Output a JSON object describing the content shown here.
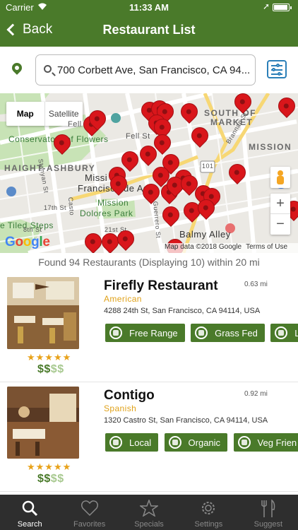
{
  "status_bar": {
    "carrier": "Carrier",
    "time": "11:33 AM"
  },
  "nav": {
    "back_label": "Back",
    "title": "Restaurant List"
  },
  "search": {
    "value": "700 Corbett Ave, San Francisco, CA 94..."
  },
  "map": {
    "type_map": "Map",
    "type_satellite": "Satellite",
    "labels": {
      "south_of_market": "SOUTH OF",
      "market": "MARKET",
      "mission": "MISSION",
      "conservatory": "Conservatory of Flowers",
      "haight_ashbury": "HAIGHT-ASHBURY",
      "fell_st": "Fell St",
      "fell_st2": "Fell St",
      "mission2": "Missi",
      "francisco": "Francisco de Asis",
      "mission_dolores": "Mission",
      "dolores_park": "Dolores Park",
      "tiled_steps": "e Tiled Steps",
      "balmy_alley": "Balmy Alley",
      "stanyan": "Stanyan St",
      "th17": "17th St",
      "guerrero": "Guerrero St",
      "brannan": "Brannan St",
      "route101": "101",
      "th21": "21st St",
      "st18": "8th St",
      "castro": "Casto"
    },
    "zoom_in": "+",
    "zoom_out": "−",
    "google": [
      "G",
      "o",
      "o",
      "g",
      "l",
      "e"
    ],
    "attribution": "Map data ©2018 Google",
    "terms": "Terms of Use"
  },
  "results": {
    "summary": "Found 94 Restaurants (Displaying 10) within 20 mi"
  },
  "restaurants": [
    {
      "name": "Firefly Restaurant",
      "distance": "0.63 mi",
      "cuisine": "American",
      "address": "4288 24th St, San Francisco, CA 94114, USA",
      "stars": "★★★★★",
      "price_on": "$$",
      "price_off": "$$",
      "tags": [
        "Free Range",
        "Grass Fed",
        "Lo"
      ],
      "tag_icons": [
        "leaf-icon",
        "cow-icon",
        "local-icon"
      ]
    },
    {
      "name": "Contigo",
      "distance": "0.92 mi",
      "cuisine": "Spanish",
      "address": "1320 Castro St, San Francisco, CA 94114, USA",
      "stars": "★★★★★",
      "price_on": "$$",
      "price_off": "$$",
      "tags": [
        "Local",
        "Organic",
        "Veg Frien"
      ],
      "tag_icons": [
        "local-icon",
        "organic-icon",
        "veg-icon"
      ]
    }
  ],
  "tabs": [
    "Search",
    "Favorites",
    "Specials",
    "Settings",
    "Suggest"
  ],
  "colors": {
    "brand_green": "#4a7a2a",
    "pin_red": "#d9161b",
    "accent_blue": "#2b7fb8",
    "cuisine_gold": "#e0a21a",
    "tabbar": "#2e2e2e"
  }
}
